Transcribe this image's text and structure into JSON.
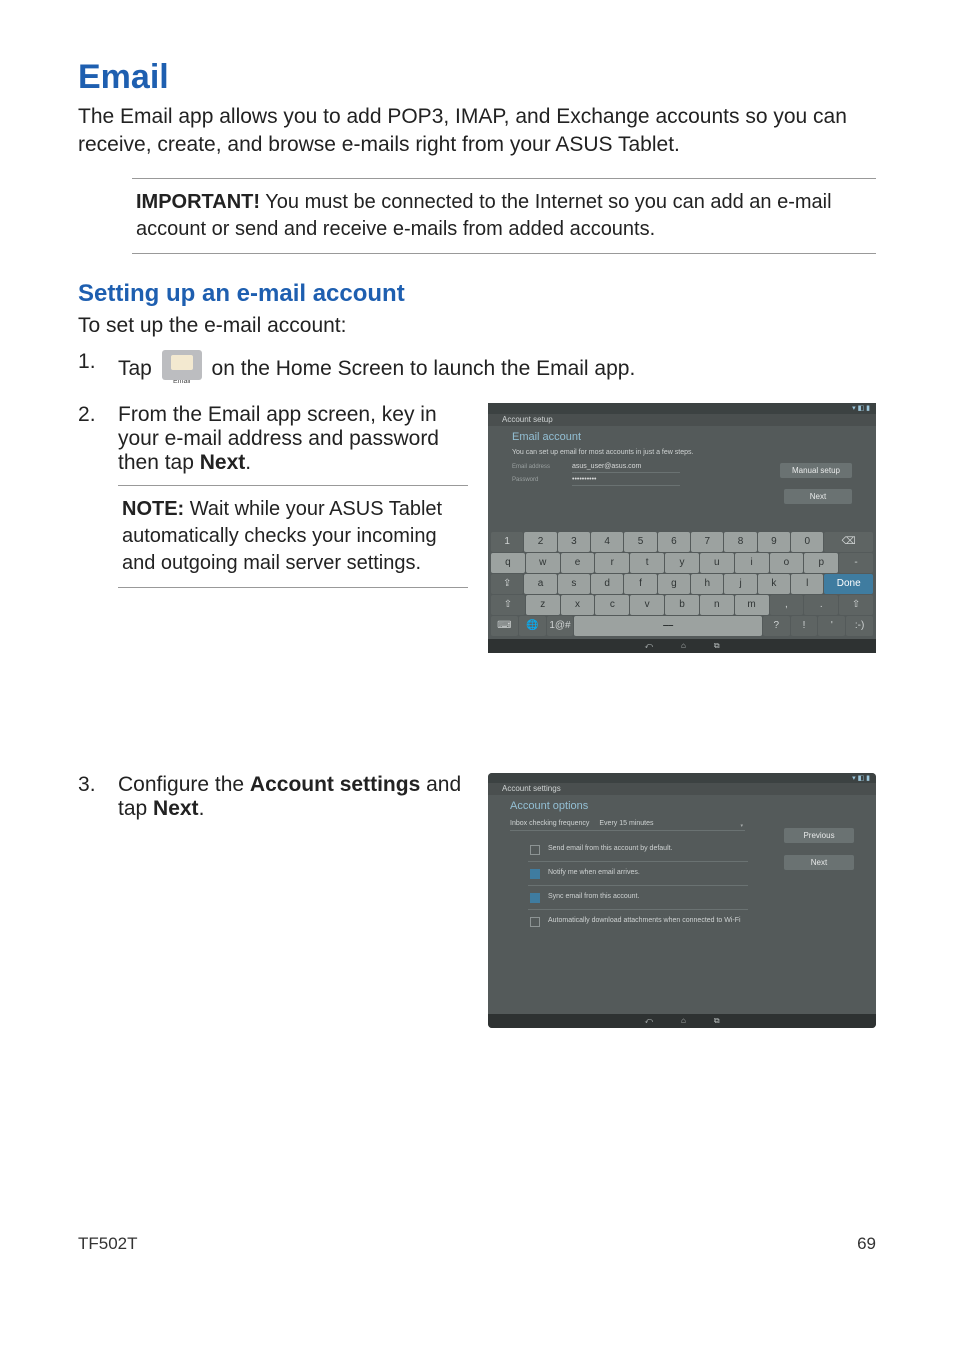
{
  "title": "Email",
  "lead": "The Email app allows you to add POP3, IMAP, and Exchange accounts so you can receive, create, and browse e-mails right from your ASUS Tablet.",
  "important_label": "IMPORTANT!",
  "important_text": " You must be connected to the Internet so you can add an e-mail account or send and receive e-mails from added accounts.",
  "subtitle": "Setting up an e-mail account",
  "intro": "To set up the e-mail account:",
  "step1_a": "Tap ",
  "step1_b": " on the Home Screen to launch the Email app.",
  "email_icon_caption": "Email",
  "step2": "From the Email app screen, key in your e-mail address and password then tap ",
  "step2_bold": "Next",
  "step2_end": ".",
  "note_label": "NOTE:",
  "note_text": " Wait while your ASUS Tablet automatically checks your incoming and outgoing mail server settings.",
  "step3_a": "Configure the ",
  "step3_bold1": "Account settings",
  "step3_b": " and tap ",
  "step3_bold2": "Next",
  "step3_c": ".",
  "footer_model": "TF502T",
  "footer_page": "69",
  "shot1": {
    "appbar": "Account setup",
    "header": "Email account",
    "sub": "You can set up email for most accounts in just a few steps.",
    "field_email_label": "Email address",
    "field_email_value": "asus_user@asus.com",
    "field_pw_label": "Password",
    "field_pw_value": "••••••••••",
    "btn_manual": "Manual setup",
    "btn_next": "Next",
    "kb_rows": {
      "r1": [
        "1",
        "2",
        "3",
        "4",
        "5",
        "6",
        "7",
        "8",
        "9",
        "0",
        "⌫"
      ],
      "r2": [
        "q",
        "w",
        "e",
        "r",
        "t",
        "y",
        "u",
        "i",
        "o",
        "p",
        "-"
      ],
      "r3": [
        "a",
        "s",
        "d",
        "f",
        "g",
        "h",
        "j",
        "k",
        "l",
        "Done"
      ],
      "r4": [
        "z",
        "x",
        "c",
        "v",
        "b",
        "n",
        "m",
        ",",
        "."
      ],
      "r5_left1": "⌨",
      "r5_left2": "🌐",
      "r5_sym": "1@#",
      "r5_q": "?",
      "r5_ex": "!",
      "r5_ap": "'",
      "r5_smile": ":-)"
    },
    "nav": [
      "⤺",
      "⌂",
      "⧉"
    ]
  },
  "shot2": {
    "appbar": "Account settings",
    "header": "Account options",
    "freq_label": "Inbox checking frequency",
    "freq_value": "Every 15 minutes",
    "opts": [
      {
        "checked": false,
        "label": "Send email from this account by default."
      },
      {
        "checked": true,
        "label": "Notify me when email arrives."
      },
      {
        "checked": true,
        "label": "Sync email from this account."
      },
      {
        "checked": false,
        "label": "Automatically download attachments when connected to Wi-Fi"
      }
    ],
    "btn_prev": "Previous",
    "btn_next": "Next",
    "nav": [
      "⤺",
      "⌂",
      "⧉"
    ]
  }
}
